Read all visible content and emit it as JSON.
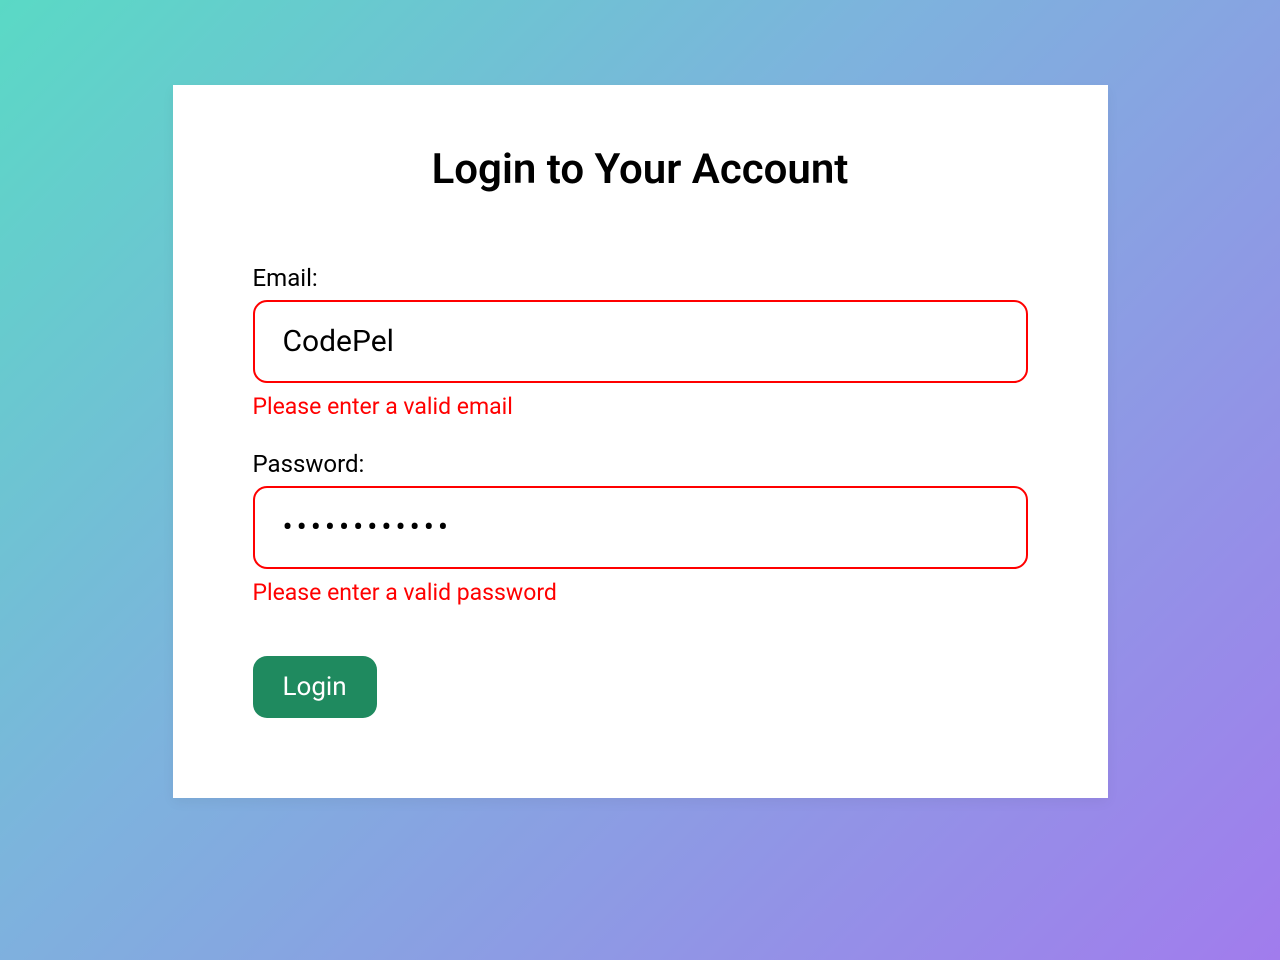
{
  "form": {
    "title": "Login to Your Account",
    "email": {
      "label": "Email:",
      "value": "CodePel",
      "error": "Please enter a valid email"
    },
    "password": {
      "label": "Password:",
      "value": "••••••••••••",
      "error": "Please enter a valid password"
    },
    "submit_label": "Login"
  },
  "colors": {
    "error": "#ff0000",
    "button": "#1f8a5f"
  }
}
